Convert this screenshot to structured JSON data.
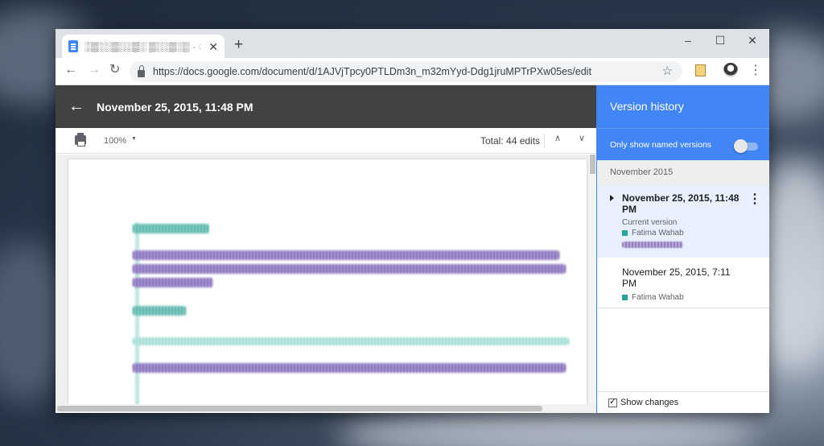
{
  "browser": {
    "tab_title": "░▒░░▒░░▒░ ▒░░▒░▒ - Goo",
    "new_tab_symbol": "+",
    "close_symbol": "✕",
    "url": "https://docs.google.com/document/d/1AJVjTpcy0PTLDm3n_m32mYyd-Ddg1jruMPTrPXw05es/edit",
    "window_controls": {
      "minimize": "–",
      "maximize": "☐",
      "close": "✕"
    },
    "nav": {
      "back": "←",
      "forward": "→",
      "reload": "↻",
      "bookmark": "☆",
      "menu": "⋮"
    }
  },
  "doc": {
    "header_date": "November 25, 2015, 11:48 PM",
    "back_symbol": "←",
    "zoom": "100%",
    "zoom_caret": "▼",
    "total_edits": "Total: 44 edits",
    "prev_symbol": "∧",
    "next_symbol": "∨"
  },
  "panel": {
    "title": "Version history",
    "toggle_label": "Only show named versions",
    "toggle_on": false,
    "month": "November 2015",
    "versions": [
      {
        "date": "November 25, 2015, 11:48 PM",
        "status": "Current version",
        "author": "Fatima Wahab",
        "selected": true
      },
      {
        "date": "November 25, 2015, 7:11 PM",
        "author": "Fatima Wahab",
        "selected": false
      }
    ],
    "more_symbol": "⋮",
    "show_changes_label": "Show changes",
    "show_changes_checked": true
  },
  "colors": {
    "accent": "#4285f4",
    "author_swatch": "#26a69a",
    "dark_header": "#424242"
  }
}
